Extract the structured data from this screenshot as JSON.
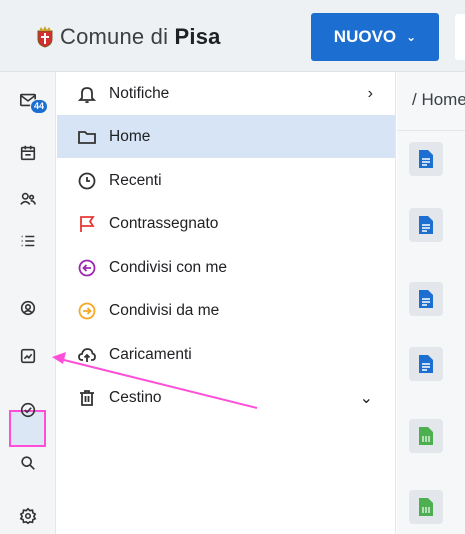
{
  "header": {
    "brand_prefix": "Comune di ",
    "brand_bold": "Pisa",
    "new_button_label": "NUOVO"
  },
  "rail": {
    "mail_badge": "44",
    "icons": [
      "mail-icon",
      "calendar-icon",
      "contacts-icon",
      "tasks-icon",
      "chat-icon",
      "files-icon",
      "check-icon",
      "search-icon",
      "settings-icon"
    ]
  },
  "nav": {
    "items": [
      {
        "label": "Notifiche",
        "icon": "bell-icon",
        "trail": "›"
      },
      {
        "label": "Home",
        "icon": "folder-icon",
        "active": true
      },
      {
        "label": "Recenti",
        "icon": "clock-icon"
      },
      {
        "label": "Contrassegnato",
        "icon": "flag-icon",
        "color": "#e53935"
      },
      {
        "label": "Condivisi con me",
        "icon": "shared-with-me-icon",
        "color": "#9c27b0"
      },
      {
        "label": "Condivisi da me",
        "icon": "shared-by-me-icon",
        "color": "#f9a825"
      },
      {
        "label": "Caricamenti",
        "icon": "upload-cloud-icon"
      },
      {
        "label": "Cestino",
        "icon": "trash-icon",
        "trail": "⌄"
      }
    ]
  },
  "content": {
    "breadcrumb": "/ Home",
    "files": [
      {
        "type": "document",
        "color": "#1c6fd1"
      },
      {
        "type": "document",
        "color": "#1c6fd1"
      },
      {
        "type": "document",
        "color": "#1c6fd1"
      },
      {
        "type": "document",
        "color": "#1c6fd1"
      },
      {
        "type": "spreadsheet",
        "color": "#4caf50"
      },
      {
        "type": "spreadsheet",
        "color": "#4caf50"
      }
    ]
  },
  "colors": {
    "accent": "#1c6fd1",
    "annotation": "#ff4fd8"
  }
}
